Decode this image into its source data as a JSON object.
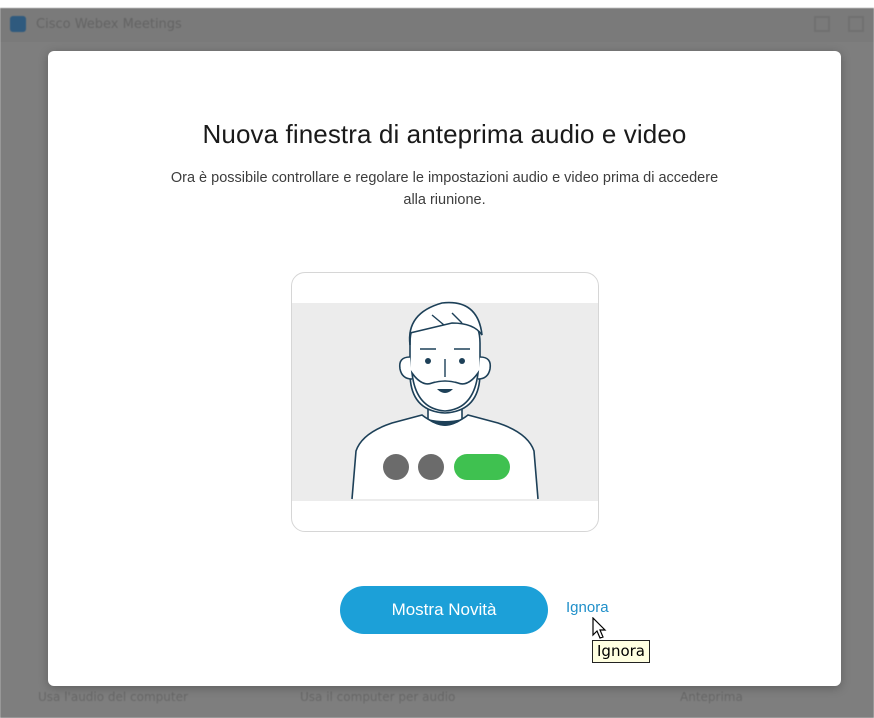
{
  "app": {
    "window_title": "Cisco Webex Meetings"
  },
  "background_bar": {
    "items": [
      "Usa l'audio del computer",
      "Usa il computer per audio",
      "Anteprima"
    ]
  },
  "modal": {
    "title": "Nuova finestra di anteprima audio e video",
    "subtitle": "Ora è possibile controllare e regolare le impostazioni audio e video prima di accedere alla riunione.",
    "primary_button_label": "Mostra Novità",
    "dismiss_link_label": "Ignora"
  },
  "tooltip": {
    "text": "Ignora"
  },
  "colors": {
    "primary": "#1ca0d8",
    "link": "#1f8fc9",
    "accent_green": "#3fc150",
    "illustration_dot_gray": "#6b6b6b",
    "illustration_line": "#1d4058",
    "overlay": "#7e7e7e"
  },
  "icons": {
    "cursor": "mouse-pointer-icon",
    "illustration": "person-preview-illustration"
  }
}
